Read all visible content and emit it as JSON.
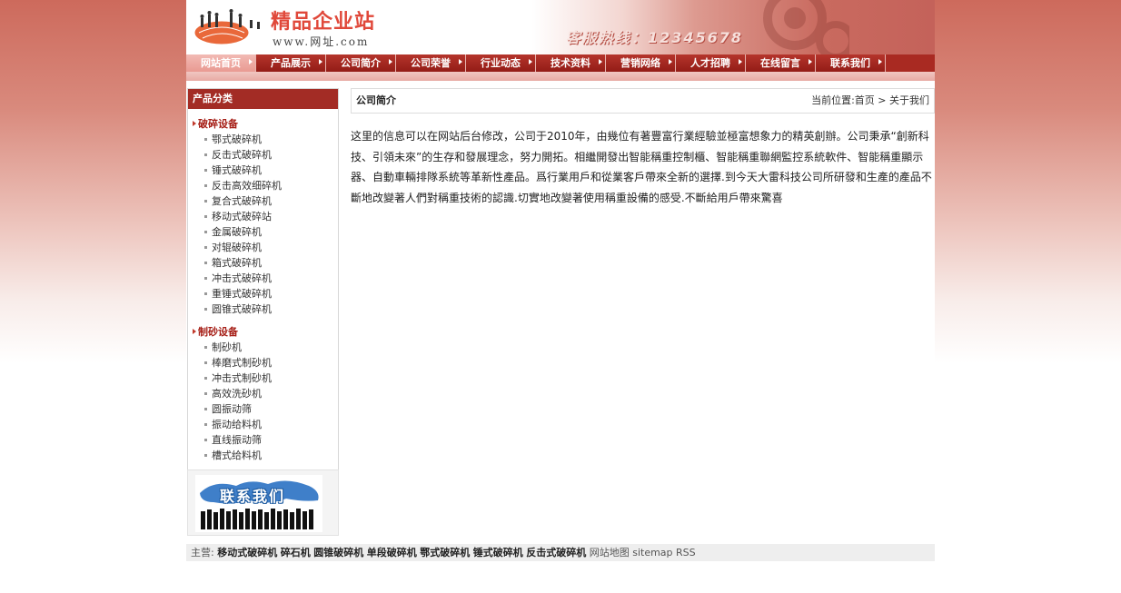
{
  "header": {
    "site_title": "精品企业站",
    "site_url": "www.网址.com",
    "hotline": "客服热线：12345678"
  },
  "nav": {
    "items": [
      {
        "label": "网站首页",
        "active": true
      },
      {
        "label": "产品展示"
      },
      {
        "label": "公司简介"
      },
      {
        "label": "公司荣誉"
      },
      {
        "label": "行业动态"
      },
      {
        "label": "技术资料"
      },
      {
        "label": "营销网络"
      },
      {
        "label": "人才招聘"
      },
      {
        "label": "在线留言"
      },
      {
        "label": "联系我们"
      }
    ]
  },
  "sidebar": {
    "heading": "产品分类",
    "categories": [
      {
        "label": "破碎设备",
        "items": [
          "鄂式破碎机",
          "反击式破碎机",
          "锤式破碎机",
          "反击高效细碎机",
          "复合式破碎机",
          "移动式破碎站",
          "金属破碎机",
          "对辊破碎机",
          "箱式破碎机",
          "冲击式破碎机",
          "重锤式破碎机",
          "圆锥式破碎机"
        ]
      },
      {
        "label": "制砂设备",
        "items": [
          "制砂机",
          "棒磨式制砂机",
          "冲击式制砂机",
          "高效洗砂机",
          "圆振动筛",
          "振动给料机",
          "直线振动筛",
          "槽式给料机"
        ]
      }
    ],
    "contact_banner": "联系我们"
  },
  "main": {
    "title": "公司简介",
    "breadcrumb": "当前位置:首页 > 关于我们",
    "body": "这里的信息可以在网站后台修改，公司于2010年，由幾位有著豐富行業經驗並極富想象力的精英創辦。公司秉承“創新科技、引領未來”的生存和發展理念，努力開拓。相繼開發出智能稱重控制櫃、智能稱重聯網監控系統軟件、智能稱重顯示器、自動車輛排隊系統等革新性產品。爲行業用戶和從業客戶帶來全新的選擇.到今天大雷科技公司所研發和生產的產品不斷地改變著人們對稱重技術的認識.切實地改變著使用稱重設備的感受.不斷給用戶帶來驚喜"
  },
  "footer": {
    "prefix": "主营:",
    "links": [
      "移动式破碎机",
      "碎石机",
      "圆锥破碎机",
      "单段破碎机",
      "鄂式破碎机",
      "锤式破碎机",
      "反击式破碎机"
    ],
    "extra": "网站地图 sitemap RSS"
  }
}
